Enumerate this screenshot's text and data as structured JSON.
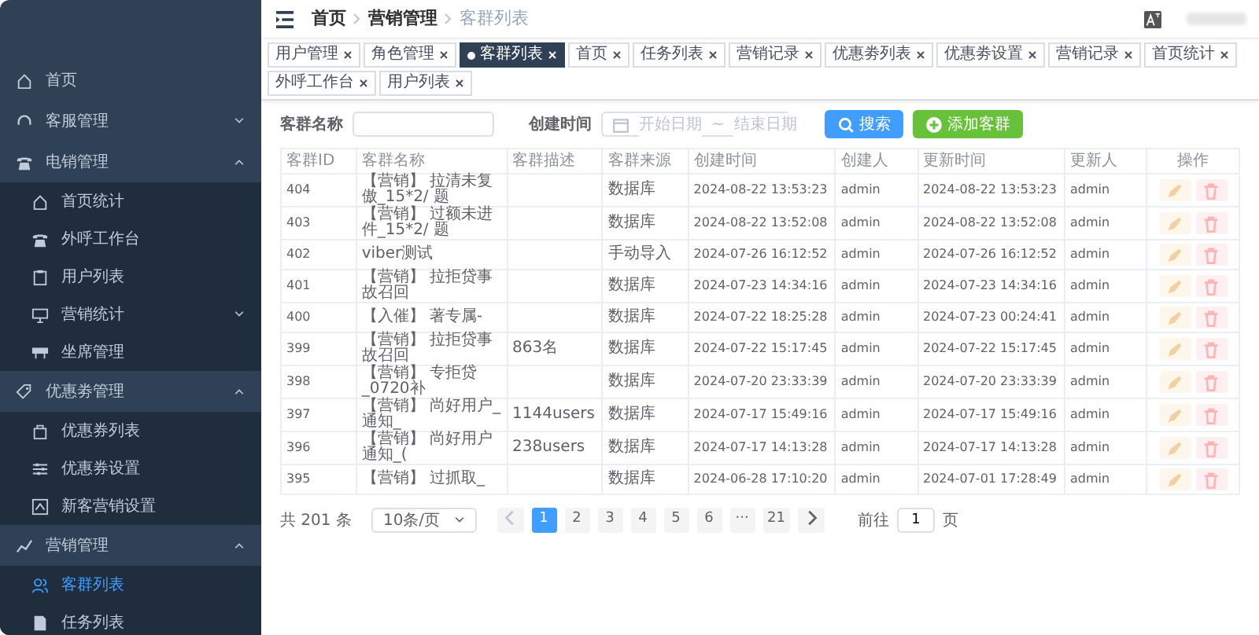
{
  "sidebar": {
    "items": [
      {
        "label": "首页",
        "selected": false
      },
      {
        "label": "客服管理",
        "expanded": false,
        "selected": false
      },
      {
        "label": "电销管理",
        "expanded": true,
        "selected": false,
        "children": [
          {
            "label": "首页统计",
            "selected": false
          },
          {
            "label": "外呼工作台",
            "selected": false
          },
          {
            "label": "用户列表",
            "selected": false
          },
          {
            "label": "营销统计",
            "selected": false,
            "expanded": false
          },
          {
            "label": "坐席管理",
            "selected": false
          }
        ]
      },
      {
        "label": "优惠劵管理",
        "expanded": true,
        "selected": false,
        "children": [
          {
            "label": "优惠券列表",
            "selected": false
          },
          {
            "label": "优惠券设置",
            "selected": false
          },
          {
            "label": "新客营销设置",
            "selected": false
          }
        ]
      },
      {
        "label": "营销管理",
        "expanded": true,
        "selected": false,
        "children": [
          {
            "label": "客群列表",
            "selected": true
          },
          {
            "label": "任务列表",
            "selected": false
          }
        ]
      }
    ]
  },
  "breadcrumb": [
    "首页",
    "营销管理",
    "客群列表"
  ],
  "tabs": [
    {
      "label": "用户管理",
      "selected": false
    },
    {
      "label": "角色管理",
      "selected": false
    },
    {
      "label": "客群列表",
      "selected": true
    },
    {
      "label": "首页",
      "selected": false
    },
    {
      "label": "任务列表",
      "selected": false
    },
    {
      "label": "营销记录",
      "selected": false
    },
    {
      "label": "优惠劵列表",
      "selected": false
    },
    {
      "label": "优惠劵设置",
      "selected": false
    },
    {
      "label": "营销记录",
      "selected": false
    },
    {
      "label": "首页统计",
      "selected": false
    },
    {
      "label": "外呼工作台",
      "selected": false
    },
    {
      "label": "用户列表",
      "selected": false
    }
  ],
  "filters": {
    "name_label": "客群名称",
    "date_label": "创建时间",
    "start_placeholder": "开始日期",
    "separator": "~",
    "end_placeholder": "结束日期",
    "search_button": "搜索",
    "add_button": "添加客群"
  },
  "table": {
    "columns": [
      "客群ID",
      "客群名称",
      "客群描述",
      "客群来源",
      "创建时间",
      "创建人",
      "更新时间",
      "更新人",
      "操作"
    ],
    "rows": [
      [
        "404",
        "【营销】 拉清未复傲_15*2/ 题",
        "",
        "数据库",
        "2024-08-22 13:53:23",
        "admin",
        "2024-08-22 13:53:23",
        "admin"
      ],
      [
        "403",
        "【营销】 过额未进件_15*2/ 题",
        "",
        "数据库",
        "2024-08-22 13:52:08",
        "admin",
        "2024-08-22 13:52:08",
        "admin"
      ],
      [
        "402",
        "viber测试",
        "",
        "手动导入",
        "2024-07-26 16:12:52",
        "admin",
        "2024-07-26 16:12:52",
        "admin"
      ],
      [
        "401",
        "【营销】 拉拒贷事故召回",
        "",
        "数据库",
        "2024-07-23 14:34:16",
        "admin",
        "2024-07-23 14:34:16",
        "admin"
      ],
      [
        "400",
        "【入催】 著专属-",
        "",
        "数据库",
        "2024-07-22 18:25:28",
        "admin",
        "2024-07-23 00:24:41",
        "admin"
      ],
      [
        "399",
        "【营销】 拉拒贷事故召回",
        "863名",
        "数据库",
        "2024-07-22 15:17:45",
        "admin",
        "2024-07-22 15:17:45",
        "admin"
      ],
      [
        "398",
        "【营销】 专拒贷_0720补",
        "",
        "数据库",
        "2024-07-20 23:33:39",
        "admin",
        "2024-07-20 23:33:39",
        "admin"
      ],
      [
        "397",
        "【营销】 尚好用户_通知_",
        "1144users",
        "数据库",
        "2024-07-17 15:49:16",
        "admin",
        "2024-07-17 15:49:16",
        "admin"
      ],
      [
        "396",
        "【营销】 尚好用户通知_(",
        "238users",
        "数据库",
        "2024-07-17 14:13:28",
        "admin",
        "2024-07-17 14:13:28",
        "admin"
      ],
      [
        "395",
        "【营销】 过抓取_",
        "",
        "数据库",
        "2024-06-28 17:10:20",
        "admin",
        "2024-07-01 17:28:49",
        "admin"
      ]
    ]
  },
  "pagination": {
    "total": "共 201 条",
    "page_size": "10条/页",
    "pages": [
      {
        "label": "1",
        "selected": true
      },
      {
        "label": "2",
        "selected": false
      },
      {
        "label": "3",
        "selected": false
      },
      {
        "label": "4",
        "selected": false
      },
      {
        "label": "5",
        "selected": false
      },
      {
        "label": "6",
        "selected": false
      },
      {
        "label": "···",
        "selected": false
      },
      {
        "label": "21",
        "selected": false
      }
    ],
    "goto_label": "前往",
    "goto_value": "1",
    "goto_suffix": "页"
  }
}
